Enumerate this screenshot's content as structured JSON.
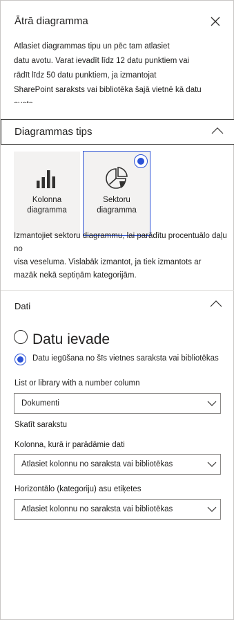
{
  "header": {
    "title": "Ātrā diagramma"
  },
  "intro": {
    "lines": [
      "Atlasiet diagrammas tipu un pēc tam atlasiet",
      "datu avotu. Varat ievadīt līdz 12 datu punktiem vai",
      "rādīt līdz 50 datu punktiem, ja izmantojat",
      "SharePoint saraksts vai bibliotēka šajā vietnē kā datu",
      "avots."
    ]
  },
  "chart_type_section": {
    "title": "Diagrammas tips",
    "tiles": [
      {
        "label_line1": "Kolonna",
        "label_line2": "diagramma",
        "icon": "column-chart-icon",
        "selected": false
      },
      {
        "label_line1": "Sektoru diagramma",
        "label_line2": "",
        "icon": "pie-chart-icon",
        "selected": true
      }
    ],
    "description": [
      "Izmantojiet sektoru diagrammu, lai parādītu procentuālo daļu no",
      "visa veseluma. Vislabāk izmantot, ja tiek izmantots ar",
      "mazāk nekā septiņām kategorijām."
    ]
  },
  "data_section": {
    "title": "Dati",
    "option_manual": "Datu ievade",
    "option_list": "Datu iegūšana no šīs vietnes saraksta vai bibliotēkas",
    "list_label": "List or library with a number column",
    "list_value": "Dokumenti",
    "view_list_link": "Skatīt sarakstu",
    "column_label": "Kolonna, kurā ir parādāmie dati",
    "column_value": "Atlasiet kolonnu no saraksta vai bibliotēkas",
    "axis_label": "Horizontālo (kategoriju) asu etiķetes",
    "axis_value": "Atlasiet kolonnu no saraksta vai bibliotēkas"
  },
  "colors": {
    "accent": "#2b52d6",
    "text": "#201f1e",
    "tile_bg": "#f3f2f1"
  }
}
